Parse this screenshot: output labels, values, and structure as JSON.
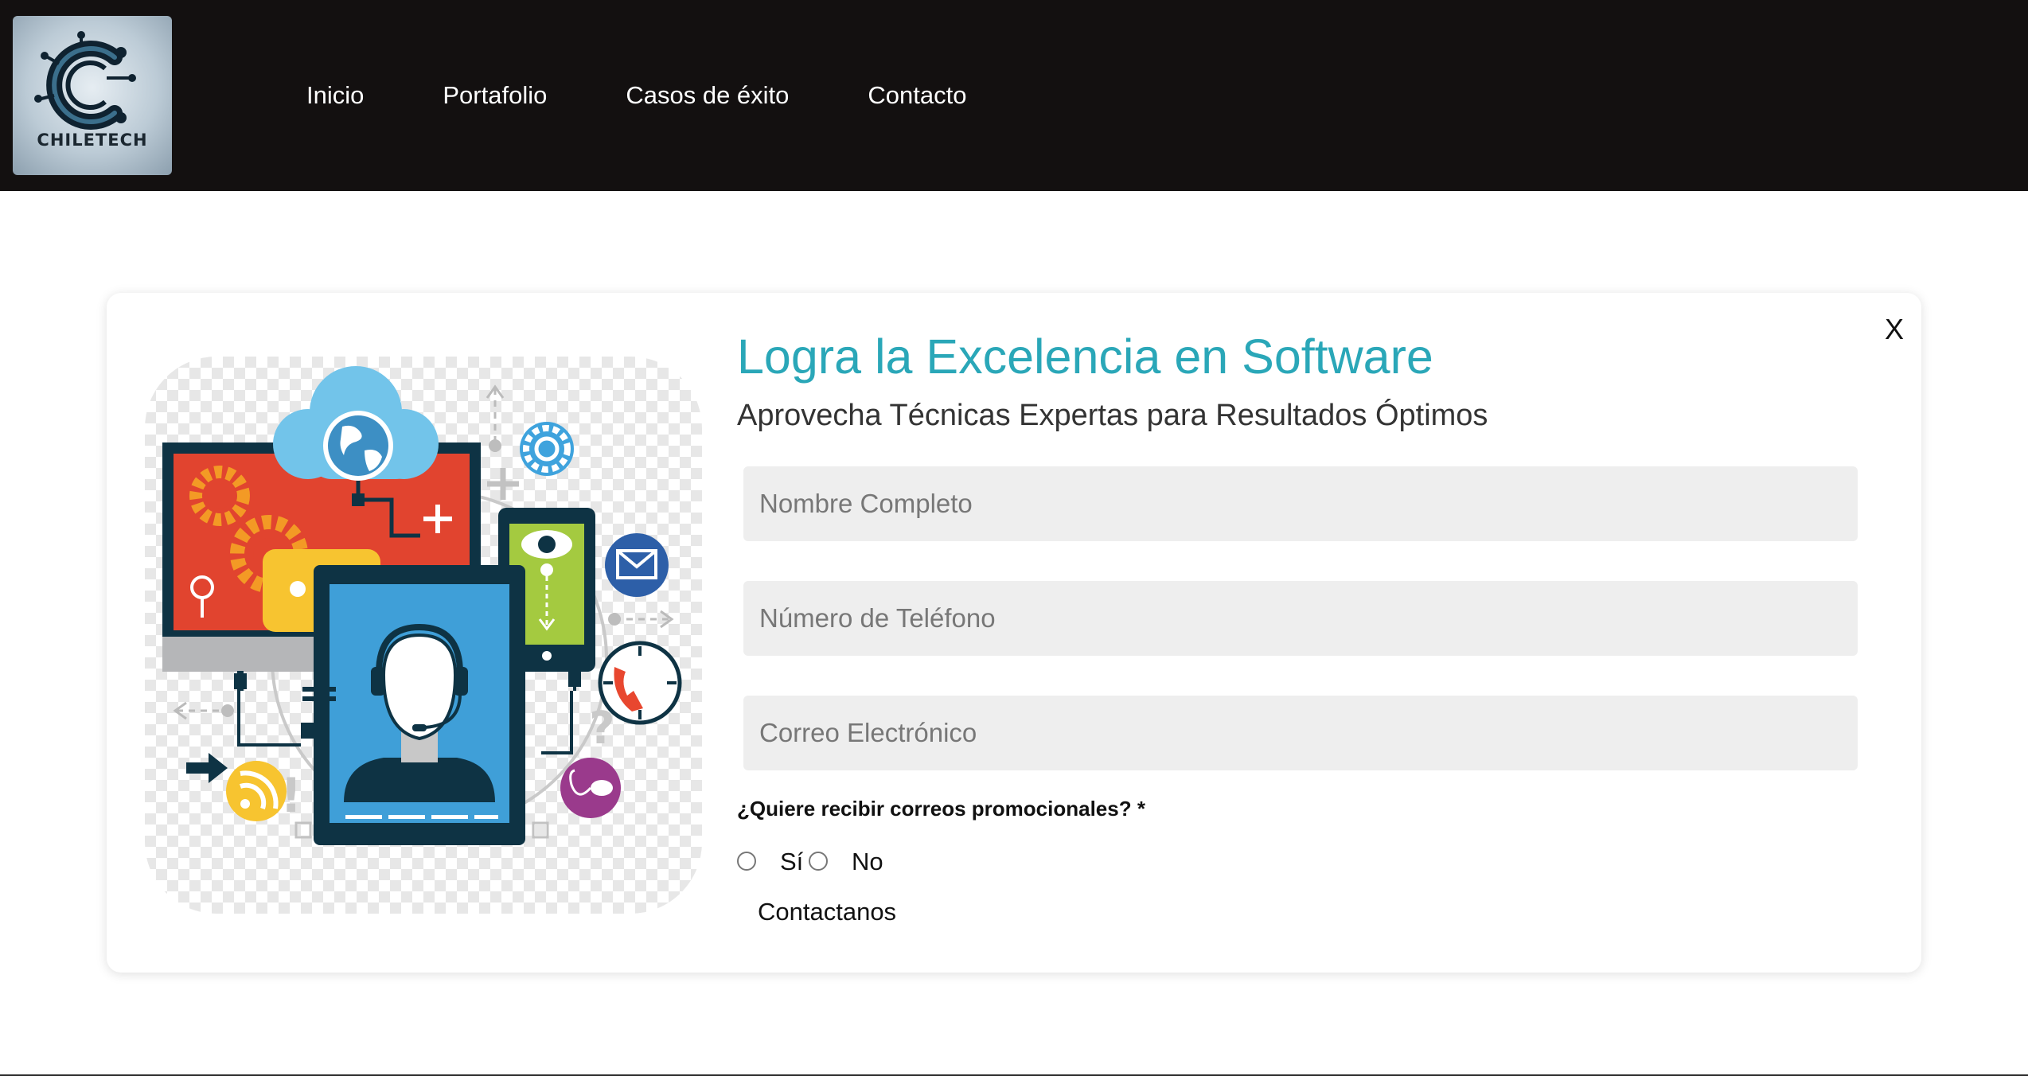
{
  "header": {
    "logo_text": "CHILETECH",
    "nav": [
      "Inicio",
      "Portafolio",
      "Casos de éxito",
      "Contacto"
    ]
  },
  "form": {
    "close_label": "X",
    "title": "Logra la Excelencia en Software",
    "subtitle": "Aprovecha Técnicas Expertas para Resultados Óptimos",
    "fields": {
      "name_placeholder": "Nombre Completo",
      "phone_placeholder": "Número de Teléfono",
      "email_placeholder": "Correo Electrónico"
    },
    "promo_question": "¿Quiere recibir correos promocionales? *",
    "options": {
      "yes": "Sí",
      "no": "No"
    },
    "selected_option": null,
    "submit_label": "Contactanos"
  },
  "colors": {
    "header_bg": "#131010",
    "title": "#2aa7b8",
    "field_bg": "#eeeeee"
  },
  "icons": [
    "cloud-globe-icon",
    "gear-icon",
    "monitor-icon",
    "chat-bubble-icon",
    "agent-headset-icon",
    "phone-eye-icon",
    "mail-icon",
    "clock-phone-icon",
    "rss-icon",
    "mouse-icon",
    "arrow-icon"
  ]
}
